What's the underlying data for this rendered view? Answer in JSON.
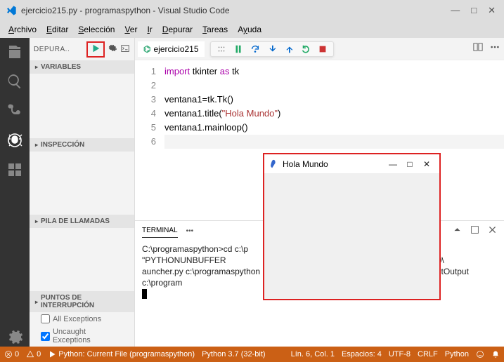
{
  "titlebar": {
    "text": "ejercicio215.py - programaspython - Visual Studio Code"
  },
  "menu": [
    "Archivo",
    "Editar",
    "Selección",
    "Ver",
    "Ir",
    "Depurar",
    "Tareas",
    "Ayuda"
  ],
  "sidebar": {
    "header": "DEPURA..",
    "sections": {
      "variables": "VARIABLES",
      "inspeccion": "INSPECCIÓN",
      "pila": "PILA DE LLAMADAS",
      "breakpoints": "PUNTOS DE INTERRUPCIÓN"
    },
    "bp1": "All Exceptions",
    "bp2": "Uncaught Exceptions"
  },
  "tab": {
    "filename": "ejercicio215"
  },
  "code": {
    "l1a": "import",
    "l1b": " tkinter ",
    "l1c": "as",
    "l1d": " tk",
    "l3": "ventana1=tk.Tk()",
    "l4a": "ventana1.title(",
    "l4b": "\"Hola Mundo\"",
    "l4c": ")",
    "l5": "ventana1.mainloop()"
  },
  "terminal": {
    "label": "TERMINAL",
    "text": "C:\\programaspython>cd c:\\p                               NCODING=UTF-8\" && set \"PYTHONUNBUFFER                                xtensions\\ms-python.python-2018.6.0\\                                 auncher.py c:\\programaspython 65239 a                                rectOutput, RedirectOutput c:\\program"
  },
  "status": {
    "errors": "0",
    "warnings": "0",
    "launch": "Python: Current File (programaspython)",
    "interpreter": "Python 3.7 (32-bit)",
    "pos": "Lín. 6, Col. 1",
    "spaces": "Espacios: 4",
    "enc": "UTF-8",
    "eol": "CRLF",
    "lang": "Python"
  },
  "popup": {
    "title": "Hola Mundo"
  }
}
